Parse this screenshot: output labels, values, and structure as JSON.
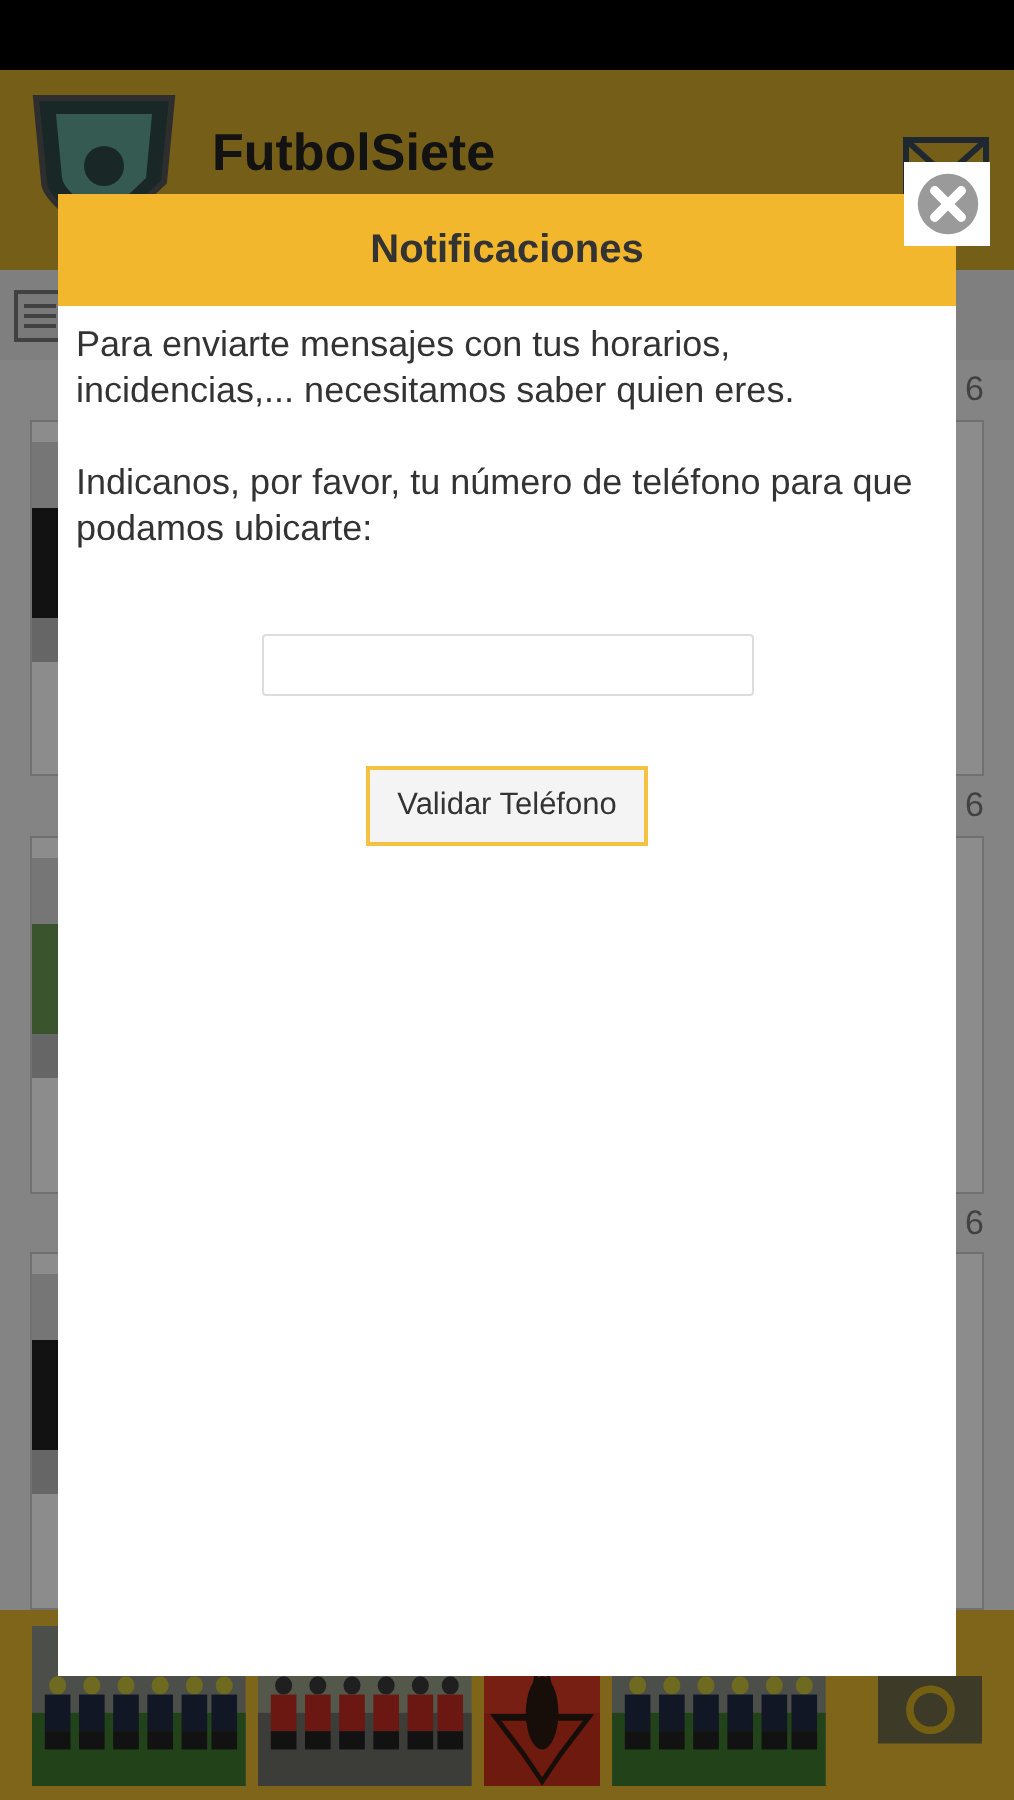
{
  "app": {
    "title": "FutbolSiete"
  },
  "cards": [
    {
      "date": "6"
    },
    {
      "date": "6"
    },
    {
      "date": "6"
    }
  ],
  "dialog": {
    "title": "Notificaciones",
    "paragraphs": [
      "Para enviarte mensajes con tus horarios, incidencias,... necesitamos saber quien eres.",
      "Indicanos, por favor, tu número de teléfono para que podamos ubicarte:"
    ],
    "button": "Validar Teléfono"
  }
}
